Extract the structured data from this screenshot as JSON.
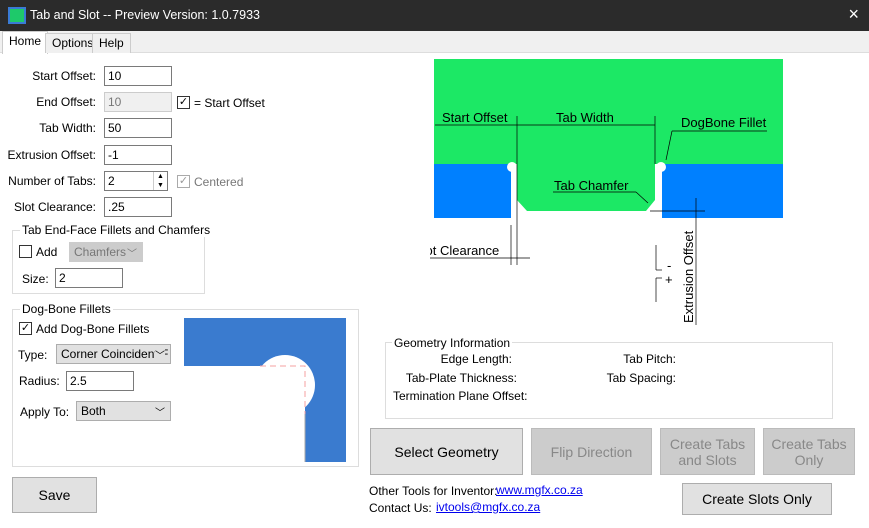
{
  "window": {
    "title": "Tab and Slot  --  Preview Version: 1.0.7933",
    "close_icon": "×"
  },
  "tabs": [
    {
      "label": "Home"
    },
    {
      "label": "Options"
    },
    {
      "label": "Help"
    }
  ],
  "form": {
    "start_offset": {
      "label": "Start Offset:",
      "value": "10"
    },
    "end_offset": {
      "label": "End Offset:",
      "value": "10",
      "checkbox_label": "= Start Offset",
      "checked": true
    },
    "tab_width": {
      "label": "Tab Width:",
      "value": "50"
    },
    "extrusion_offset": {
      "label": "Extrusion Offset:",
      "value": "-1"
    },
    "number_of_tabs": {
      "label": "Number of Tabs:",
      "value": "2",
      "centered_label": "Centered",
      "centered_checked": true
    },
    "slot_clearance": {
      "label": "Slot Clearance:",
      "value": ".25"
    }
  },
  "end_face": {
    "title": "Tab End-Face Fillets and Chamfers",
    "add_label": "Add",
    "add_checked": false,
    "type_value": "Chamfers",
    "size_label": "Size:",
    "size_value": "2"
  },
  "dog_bone": {
    "title": "Dog-Bone Fillets",
    "add_label": "Add Dog-Bone Fillets",
    "add_checked": true,
    "type_label": "Type:",
    "type_value": "Corner Coincident F",
    "radius_label": "Radius:",
    "radius_value": "2.5",
    "apply_label": "Apply To:",
    "apply_value": "Both"
  },
  "diagram": {
    "start_offset": "Start Offset",
    "tab_width": "Tab Width",
    "dogbone_fillet": "DogBone Fillet",
    "tab_chamfer": "Tab Chamfer",
    "slot_clearance": "Slot Clearance",
    "extrusion_offset": "Extrusion Offset",
    "minus": "-",
    "plus": "+",
    "colors": {
      "tab": "#1ce865",
      "slot": "#0080ff"
    }
  },
  "geometry": {
    "title": "Geometry Information",
    "edge_length": "Edge Length:",
    "tab_plate_thickness": "Tab-Plate Thickness:",
    "termination_plane_offset": "Termination Plane Offset:",
    "tab_pitch": "Tab Pitch:",
    "tab_spacing": "Tab Spacing:"
  },
  "buttons": {
    "save": "Save",
    "select_geometry": "Select Geometry",
    "flip_direction": "Flip Direction",
    "create_tabs_and_slots": "Create Tabs and Slots",
    "create_tabs_only": "Create Tabs Only",
    "create_slots_only": "Create Slots Only"
  },
  "footer": {
    "other_tools_label": "Other Tools for Inventor:",
    "other_tools_link": "www.mgfx.co.za",
    "contact_label": "Contact Us:",
    "contact_link": "ivtools@mgfx.co.za"
  }
}
